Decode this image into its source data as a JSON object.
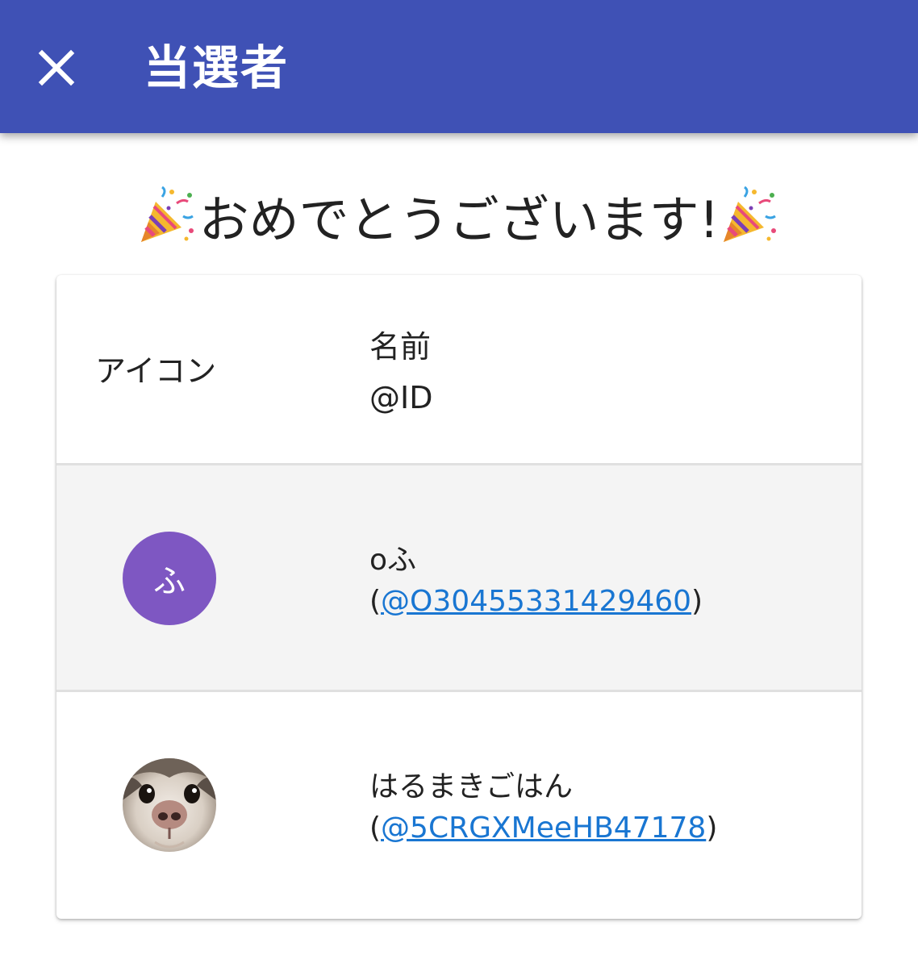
{
  "app_bar": {
    "title": "当選者",
    "close_icon": "close-icon",
    "color": "#3f51b5"
  },
  "congrats": {
    "text": "おめでとうございます!",
    "icon": "party-popper-icon"
  },
  "table": {
    "headers": {
      "icon": "アイコン",
      "name": "名前",
      "id": "@ID"
    },
    "rows": [
      {
        "avatar_type": "letter",
        "avatar_letter": "ふ",
        "avatar_color": "#7e57c2",
        "name": "oふ",
        "open_paren": "(",
        "id": "@O30455331429460",
        "close_paren": ")"
      },
      {
        "avatar_type": "photo",
        "avatar_desc": "cat-photo",
        "name": "はるまきごはん",
        "open_paren": "(",
        "id": "@5CRGXMeeHB47178",
        "close_paren": ")"
      }
    ]
  }
}
